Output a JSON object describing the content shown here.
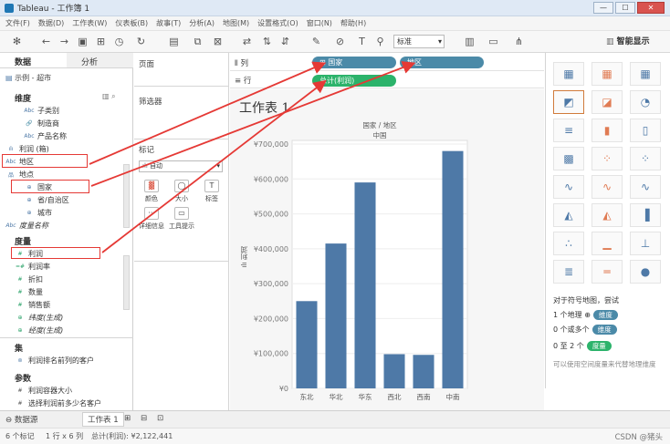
{
  "window": {
    "title": "Tableau - 工作簿 1",
    "buttons": [
      "—",
      "☐",
      "✕"
    ]
  },
  "menu": [
    "文件(F)",
    "数据(D)",
    "工作表(W)",
    "仪表板(B)",
    "故事(T)",
    "分析(A)",
    "地图(M)",
    "设置格式(O)",
    "窗口(N)",
    "帮助(H)"
  ],
  "toolbar": {
    "fit_select": "标准",
    "smart_show_label": "智能显示"
  },
  "left": {
    "tabs": [
      "数据",
      "分析"
    ],
    "datasource": "示例 - 超市",
    "dimensions_title": "维度",
    "dimensions": [
      {
        "icon": "Abc",
        "label": "子类别",
        "indent": true
      },
      {
        "icon": "🔗",
        "label": "制造商",
        "indent": true
      },
      {
        "icon": "Abc",
        "label": "产品名称",
        "indent": true
      },
      {
        "icon": "ılı",
        "label": "利润 (箱)",
        "indent": false
      },
      {
        "icon": "Abc",
        "label": "地区",
        "indent": false
      },
      {
        "icon": "品",
        "label": "地点",
        "indent": false
      },
      {
        "icon": "⊕",
        "label": "国家",
        "indent": true
      },
      {
        "icon": "⊕",
        "label": "省/自治区",
        "indent": true
      },
      {
        "icon": "⊕",
        "label": "城市",
        "indent": true
      },
      {
        "icon": "Abc",
        "label": "度量名称",
        "indent": false
      }
    ],
    "measures_title": "度量",
    "measures": [
      {
        "icon": "#",
        "label": "利润"
      },
      {
        "icon": "=#",
        "label": "利润率"
      },
      {
        "icon": "#",
        "label": "折扣"
      },
      {
        "icon": "#",
        "label": "数量"
      },
      {
        "icon": "#",
        "label": "销售额"
      },
      {
        "icon": "⊕",
        "label": "纬度(生成)"
      },
      {
        "icon": "⊕",
        "label": "经度(生成)"
      }
    ],
    "sets_title": "集",
    "sets": [
      {
        "icon": "⊚",
        "label": "利润排名前列的客户"
      }
    ],
    "params_title": "参数",
    "params": [
      {
        "icon": "#",
        "label": "利润容器大小"
      },
      {
        "icon": "#",
        "label": "选择利润前多少名客户"
      }
    ]
  },
  "middle": {
    "pages_title": "页面",
    "filters_title": "筛选器",
    "marks_title": "标记",
    "marks_select": "自动",
    "marks_buttons": [
      {
        "glyph": "▓",
        "label": "颜色"
      },
      {
        "glyph": "◯",
        "label": "大小"
      },
      {
        "glyph": "T",
        "label": "标签"
      },
      {
        "glyph": "···",
        "label": "详细信息"
      },
      {
        "glyph": "▭",
        "label": "工具提示"
      }
    ]
  },
  "shelves": {
    "columns_label": "列",
    "rows_label": "行",
    "column_pills": [
      "国家",
      "地区"
    ],
    "row_pills": [
      "总计(利润)"
    ]
  },
  "sheet": {
    "title": "工作表 1",
    "header_top": "国家 / 地区",
    "header_sub": "中国",
    "yaxis_label": "利润"
  },
  "chart_data": {
    "type": "bar",
    "categories": [
      "东北",
      "华北",
      "华东",
      "西北",
      "西南",
      "中南"
    ],
    "values": [
      250000,
      415000,
      590000,
      98000,
      96000,
      680000
    ],
    "title": "国家 / 地区",
    "subtitle": "中国",
    "ylabel": "利润",
    "ylim": [
      0,
      700000
    ],
    "y_ticks": [
      "¥700,000",
      "¥600,000",
      "¥500,000",
      "¥400,000",
      "¥300,000",
      "¥200,000",
      "¥100,000",
      "¥0"
    ],
    "color": "#4e79a7"
  },
  "right": {
    "hint_title": "对于符号地图，尝试",
    "hints": [
      {
        "prefix": "1 个地理",
        "pill": "维度",
        "color": "#4b8aa8"
      },
      {
        "prefix": "0 个或多个",
        "pill": "维度",
        "color": "#4b8aa8"
      },
      {
        "prefix": "0 至 2 个",
        "pill": "度量",
        "color": "#2cb36b"
      }
    ],
    "footnote": "可以使用空间度量来代替地理维度"
  },
  "bottom_tabs": [
    "数据源",
    "工作表 1"
  ],
  "status": {
    "marks": "6 个标记",
    "rows_cols": "1 行 x 6 列",
    "sum": "总计(利润): ¥2,122,441"
  },
  "watermark": "CSDN @猪头"
}
